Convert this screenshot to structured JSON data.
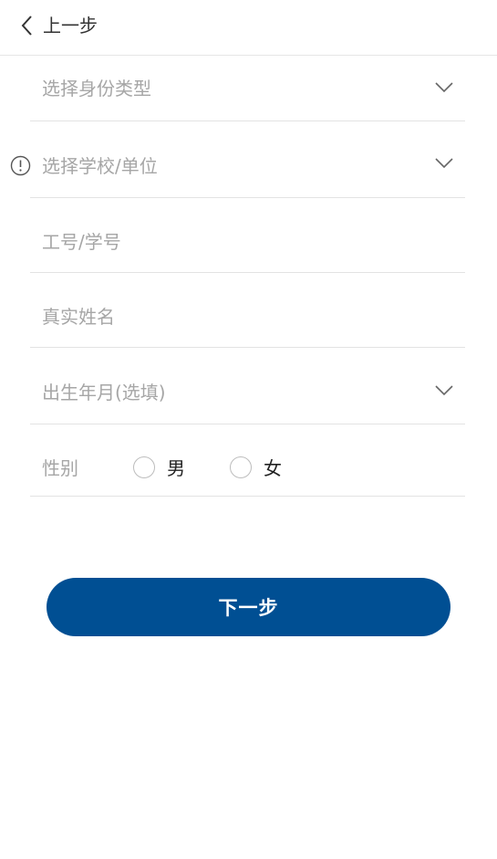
{
  "header": {
    "back_label": "上一步"
  },
  "form": {
    "identity_type": {
      "placeholder": "选择身份类型"
    },
    "school": {
      "placeholder": "选择学校/单位"
    },
    "staff_id": {
      "placeholder": "工号/学号"
    },
    "real_name": {
      "placeholder": "真实姓名"
    },
    "birth": {
      "placeholder": "出生年月(选填)"
    },
    "gender": {
      "label": "性别",
      "options": [
        "男",
        "女"
      ]
    }
  },
  "next_button": {
    "label": "下一步"
  },
  "colors": {
    "primary": "#004f93",
    "placeholder": "#a6a6a6",
    "divider": "#e3e3e3"
  }
}
